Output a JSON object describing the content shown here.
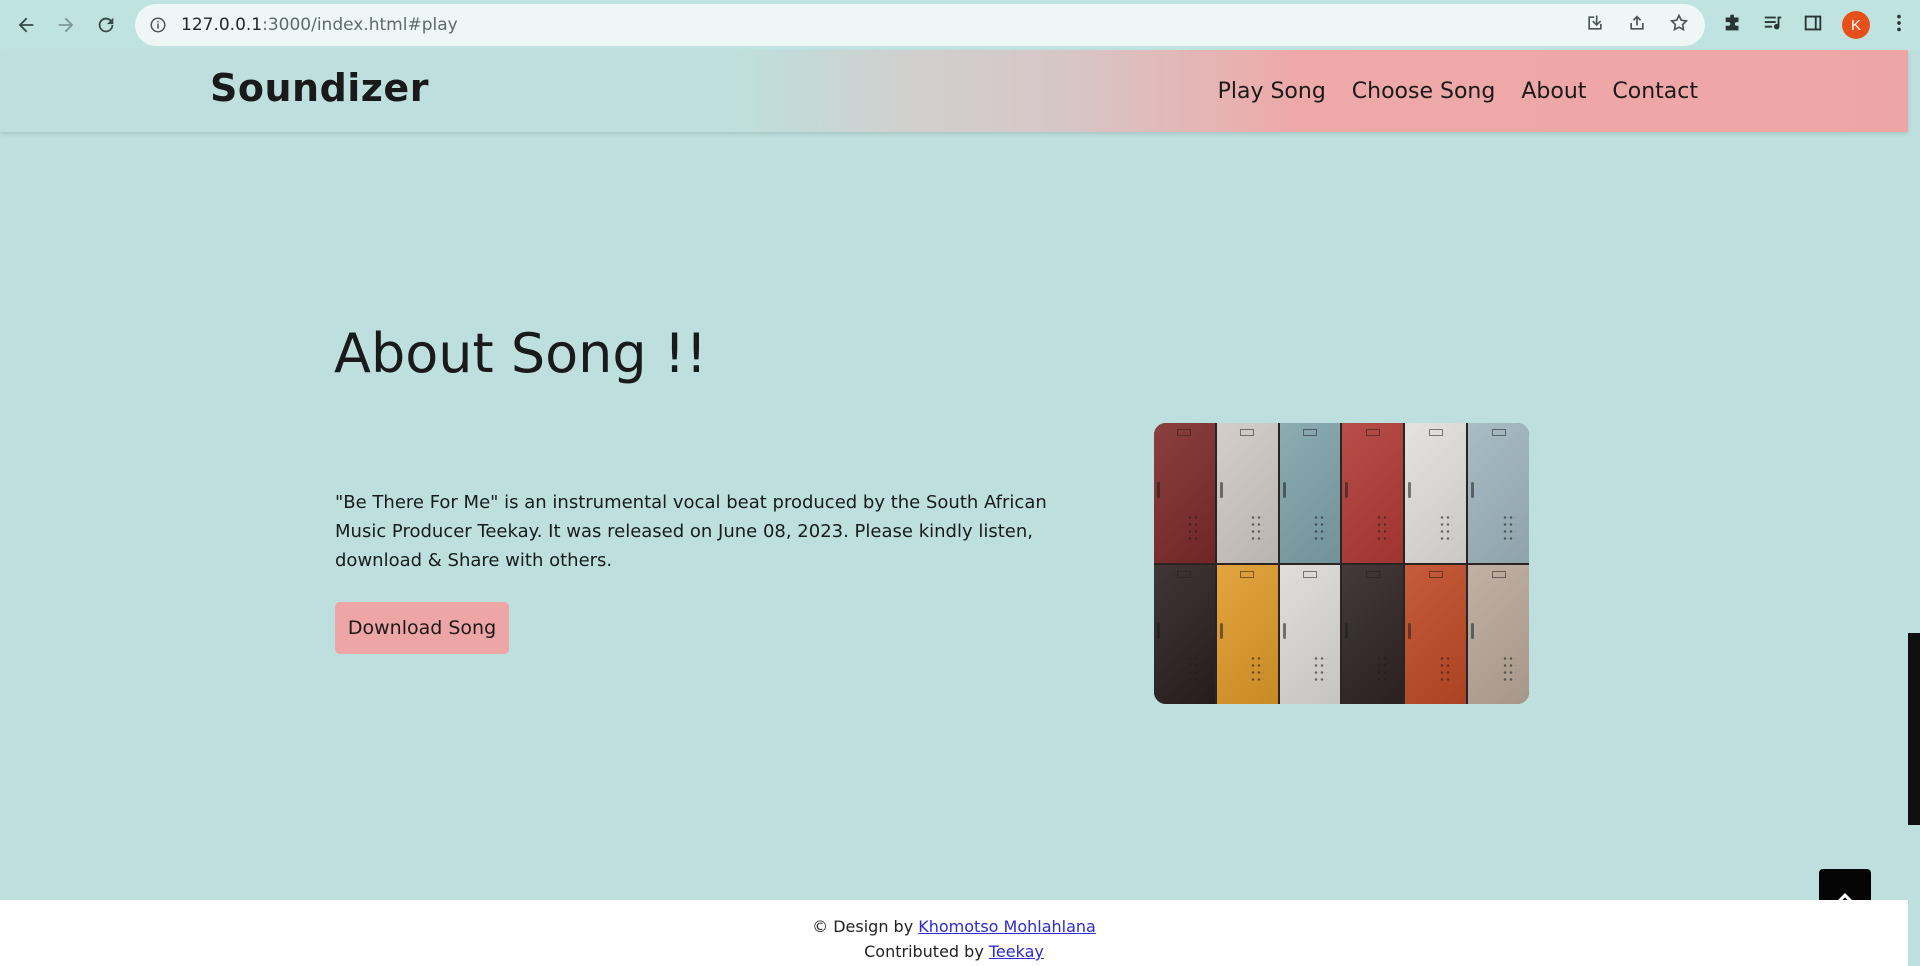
{
  "browser": {
    "url_host": "127.0.0.1",
    "url_rest": ":3000/index.html#play",
    "profile_initial": "K"
  },
  "site": {
    "brand": "Soundizer",
    "nav": [
      "Play Song",
      "Choose Song",
      "About",
      "Contact"
    ]
  },
  "main": {
    "title": "About Song !!",
    "description": "\"Be There For Me\" is an instrumental vocal beat produced by the South African Music Producer Teekay. It was released on June 08, 2023. Please kindly listen, download & Share with others.",
    "download_label": "Download Song"
  },
  "image": {
    "lockers": [
      "#7c2a28",
      "#cfc9c4",
      "#7fa3ab",
      "#b03a34",
      "#e2dedb",
      "#9fb5bf",
      "#2a1f1e",
      "#e09a2a",
      "#dcd9d6",
      "#2e2422",
      "#bf4a25",
      "#b9a898"
    ]
  },
  "footer": {
    "design_prefix": "© Design by ",
    "designer": "Khomotso Mohlahlana",
    "contrib_prefix": "Contributed by ",
    "contributor": "Teekay"
  }
}
